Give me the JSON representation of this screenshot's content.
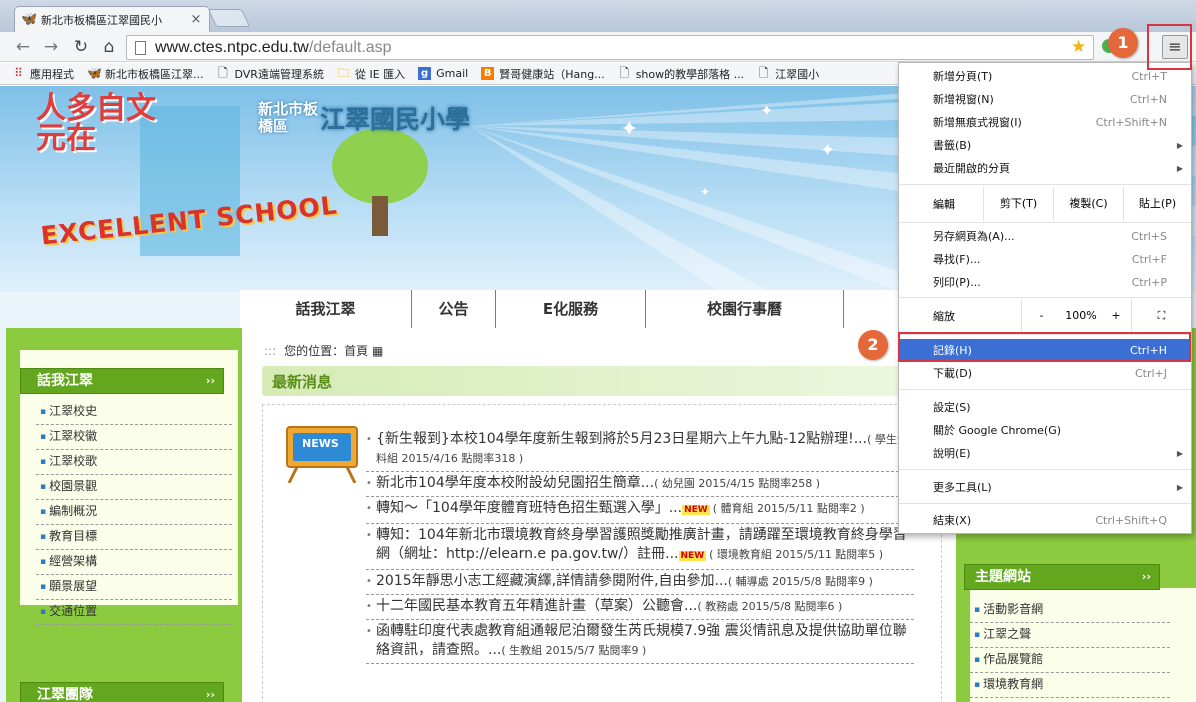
{
  "browser": {
    "tab_title": "新北市板橋區江翠國民小",
    "tab_close": "×",
    "url_host": "www.ctes.ntpc.edu.tw",
    "url_path": "/default.asp",
    "menu_button_glyph": "≡"
  },
  "bookmarks": [
    {
      "icon": "apps-icon",
      "label": "應用程式"
    },
    {
      "icon": "butterfly-icon",
      "label": "新北市板橋區江翠..."
    },
    {
      "icon": "page-icon",
      "label": "DVR遠端管理系統"
    },
    {
      "icon": "folder-icon",
      "label": "從 IE 匯入"
    },
    {
      "icon": "google-icon",
      "label": "Gmail"
    },
    {
      "icon": "blogger-icon",
      "label": "賢哥健康站（Hang..."
    },
    {
      "icon": "page-icon",
      "label": "show的教學部落格 ..."
    },
    {
      "icon": "page-icon",
      "label": "江翠國小"
    }
  ],
  "banner": {
    "slogan": "人多自文元在",
    "district": "新北市板橋區",
    "school_name": "江翠國民小學",
    "excellent": "EXCELLENT SCHOOL"
  },
  "navbar": [
    "話我江翠",
    "公告",
    "E化服務",
    "校園行事曆"
  ],
  "breadcrumb": {
    "prefix": ":::",
    "text": "您的位置：首頁"
  },
  "sidebar": {
    "title": "話我江翠",
    "more": "››",
    "items": [
      "江翠校史",
      "江翠校徽",
      "江翠校歌",
      "校園景觀",
      "編制概況",
      "教育目標",
      "經營架構",
      "願景展望",
      "交通位置"
    ],
    "title2": "江翠團隊"
  },
  "news": {
    "title": "最新消息",
    "board_label": "NEWS",
    "items": [
      {
        "text": "{新生報到}本校104學年度新生報到將於5月23日星期六上午九點-12點辦理!...",
        "meta": "( 學生資料組 2015/4/16 點閱率318 )",
        "new": ""
      },
      {
        "text": "新北市104學年度本校附設幼兒園招生簡章...",
        "meta": "( 幼兒園 2015/4/15 點閱率258 )",
        "new": ""
      },
      {
        "text": "轉知～「104學年度體育班特色招生甄選入學」...",
        "meta": "( 體育組 2015/5/11 點閱率2 )",
        "new": "NEW"
      },
      {
        "text": "轉知：104年新北市環境教育終身學習護照獎勵推廣計畫，請踴躍至環境教育終身學習網（網址：http://elearn.e pa.gov.tw/）註冊...",
        "meta": "( 環境教育組 2015/5/11 點閱率5 )",
        "new": "NEW"
      },
      {
        "text": "2015年靜思小志工經藏演繹,詳情請參閱附件,自由參加...",
        "meta": "( 輔導處 2015/5/8 點閱率9 )",
        "new": ""
      },
      {
        "text": "十二年國民基本教育五年精進計畫（草案）公聽會...",
        "meta": "( 教務處 2015/5/8 點閱率6 )",
        "new": ""
      },
      {
        "text": "函轉駐印度代表處教育組通報尼泊爾發生芮氏規模7.9強 震災情訊息及提供協助單位聯絡資訊，請查照。...",
        "meta": "( 生教組 2015/5/7 點閱率9 )",
        "new": ""
      }
    ]
  },
  "right": {
    "title": "主題網站",
    "more": "››",
    "items": [
      "活動影音網",
      "江翠之聲",
      "作品展覽館",
      "環境教育網"
    ]
  },
  "chrome_menu": {
    "new_tab": {
      "label": "新增分頁(T)",
      "shortcut": "Ctrl+T"
    },
    "new_window": {
      "label": "新增視窗(N)",
      "shortcut": "Ctrl+N"
    },
    "incognito": {
      "label": "新增無痕式視窗(I)",
      "shortcut": "Ctrl+Shift+N"
    },
    "bookmarks": {
      "label": "書籤(B)"
    },
    "recent_tabs": {
      "label": "最近開啟的分頁"
    },
    "edit": {
      "label": "編輯",
      "cut": "剪下(T)",
      "copy": "複製(C)",
      "paste": "貼上(P)"
    },
    "save_as": {
      "label": "另存網頁為(A)...",
      "shortcut": "Ctrl+S"
    },
    "find": {
      "label": "尋找(F)...",
      "shortcut": "Ctrl+F"
    },
    "print": {
      "label": "列印(P)...",
      "shortcut": "Ctrl+P"
    },
    "zoom": {
      "label": "縮放",
      "minus": "-",
      "value": "100%",
      "plus": "+",
      "fullscreen": "⛶"
    },
    "history": {
      "label": "記錄(H)",
      "shortcut": "Ctrl+H"
    },
    "downloads": {
      "label": "下載(D)",
      "shortcut": "Ctrl+J"
    },
    "settings": {
      "label": "設定(S)"
    },
    "about": {
      "label": "關於 Google Chrome(G)"
    },
    "help": {
      "label": "說明(E)"
    },
    "more_tools": {
      "label": "更多工具(L)"
    },
    "exit": {
      "label": "結束(X)",
      "shortcut": "Ctrl+Shift+Q"
    }
  },
  "annotations": {
    "step1": "1",
    "step2": "2"
  },
  "colors": {
    "accent_green": "#63a71e",
    "highlight": "#3b6fd4",
    "annotation_red": "#d9343f",
    "step_orange": "#e5683b"
  }
}
